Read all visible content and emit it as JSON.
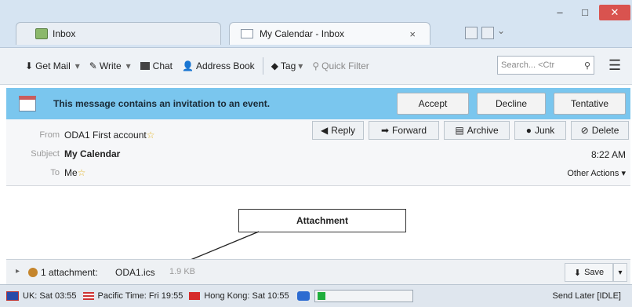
{
  "tabs": [
    {
      "label": "Inbox",
      "icon": "inbox-icon"
    },
    {
      "label": "My Calendar - Inbox",
      "icon": "mail-icon",
      "close": "×"
    }
  ],
  "window_controls": {
    "minimize": "–",
    "maximize": "□",
    "close": "✕"
  },
  "toolbar": {
    "get_mail": "Get Mail",
    "write": "Write",
    "chat": "Chat",
    "address_book": "Address Book",
    "tag": "Tag",
    "quick_filter": "Quick Filter",
    "search_placeholder": "Search... <Ctr",
    "dropdown": "▾"
  },
  "invitation": {
    "message": "This message contains an invitation to an event.",
    "accept": "Accept",
    "decline": "Decline",
    "tentative": "Tentative"
  },
  "header": {
    "from_label": "From",
    "from_value": "ODA1 First account",
    "subject_label": "Subject",
    "subject_value": "My Calendar",
    "to_label": "To",
    "to_value": "Me",
    "time": "8:22 AM",
    "other_actions": "Other Actions",
    "reply": "Reply",
    "forward": "Forward",
    "archive": "Archive",
    "junk": "Junk",
    "delete": "Delete"
  },
  "annotation": {
    "label": "Attachment"
  },
  "attachment": {
    "count": "1 attachment:",
    "filename": "ODA1.ics",
    "size": "1.9 KB",
    "save": "Save"
  },
  "status": {
    "uk": "UK: Sat 03:55",
    "pacific": "Pacific Time: Fri 19:55",
    "hongkong": "Hong Kong: Sat 10:55",
    "send_later": "Send Later [IDLE]"
  },
  "colors": {
    "invitation_bar": "#7ac6ee",
    "close_button": "#d9534f",
    "progress": "#1fae3c"
  }
}
